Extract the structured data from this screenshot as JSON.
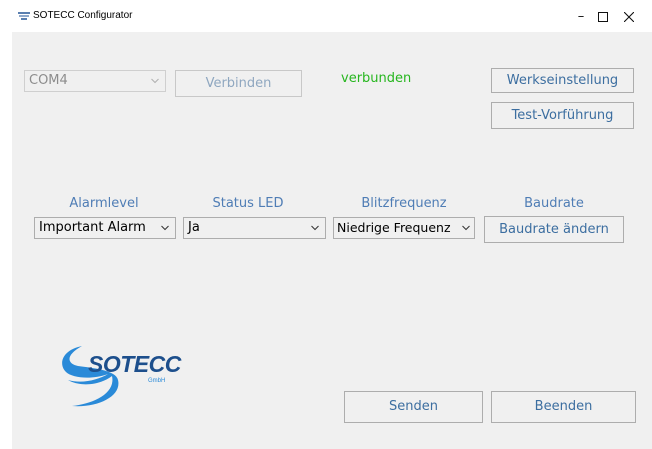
{
  "window": {
    "title": "SOTECC Configurator",
    "minimize": "–",
    "maximize": "☐",
    "close": "✕"
  },
  "connection": {
    "port_value": "COM4",
    "connect_label": "Verbinden",
    "status_text": "verbunden",
    "status_color": "#27b61f"
  },
  "actions": {
    "factory_settings_label": "Werkseinstellung",
    "test_demo_label": "Test-Vorführung",
    "send_label": "Senden",
    "exit_label": "Beenden"
  },
  "settings": {
    "alarmlevel_label": "Alarmlevel",
    "alarmlevel_value": "Important Alarm",
    "status_led_label": "Status LED",
    "status_led_value": "Ja",
    "flash_freq_label": "Blitzfrequenz",
    "flash_freq_value": "Niedrige Frequenz",
    "baudrate_label": "Baudrate",
    "baudrate_button_label": "Baudrate ändern"
  },
  "logo": {
    "name": "SOTECC",
    "suffix": "GmbH",
    "color": "#1d4f8c",
    "swoosh_color": "#2a8ad8"
  }
}
